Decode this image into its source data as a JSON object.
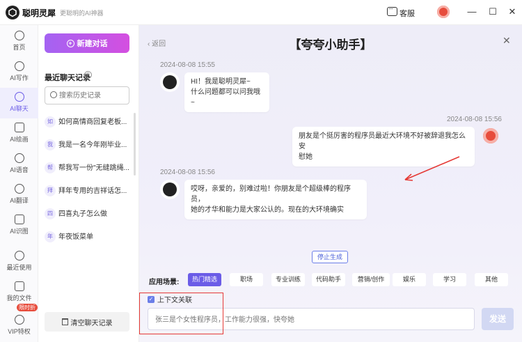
{
  "app": {
    "name": "聪明灵犀",
    "slogan": "更聪明的AI神器",
    "support_label": "客服",
    "colors": {
      "accent": "#6b5ce7",
      "new_chat_gradient": [
        "#a463f2",
        "#d44fe0"
      ],
      "highlight": "#e53935"
    }
  },
  "rail": {
    "items": [
      {
        "label": "首页",
        "icon": "hexagon-icon"
      },
      {
        "label": "AI写作",
        "icon": "pen-icon"
      },
      {
        "label": "AI聊天",
        "icon": "chat-icon",
        "active": true
      },
      {
        "label": "AI绘画",
        "icon": "brush-icon"
      },
      {
        "label": "AI语音",
        "icon": "mic-icon"
      },
      {
        "label": "AI翻译",
        "icon": "translate-icon"
      },
      {
        "label": "AI识图",
        "icon": "scan-icon"
      },
      {
        "label": "最近使用",
        "icon": "clock-icon"
      },
      {
        "label": "我的文件",
        "icon": "file-icon"
      },
      {
        "label": "VIP特权",
        "icon": "diamond-icon"
      }
    ],
    "vip_badge": "限时折"
  },
  "history": {
    "new_chat_label": "新建对话",
    "title": "最近聊天记录",
    "search_placeholder": "搜索历史记录",
    "items": [
      {
        "initial": "如",
        "text": "如何高情商回复老板..."
      },
      {
        "initial": "我",
        "text": "我是一名今年刚毕业..."
      },
      {
        "initial": "帮",
        "text": "帮我写一份\"无缝跳绳..."
      },
      {
        "initial": "拜",
        "text": "拜年专用的吉祥话怎..."
      },
      {
        "initial": "四",
        "text": "四喜丸子怎么做"
      },
      {
        "initial": "年",
        "text": "年夜饭菜单"
      }
    ],
    "clear_label": "清空聊天记录"
  },
  "chat": {
    "back_label": "返回",
    "title": "【夸夸小助手】",
    "messages": [
      {
        "role": "bot",
        "time": "2024-08-08 15:55",
        "lines": [
          "HI！我是聪明灵犀~",
          "什么问题都可以问我哦~"
        ]
      },
      {
        "role": "user",
        "time": "2024-08-08 15:56",
        "lines": [
          "朋友是个挺厉害的程序员最近大环境不好被辞退我怎么安",
          "慰她"
        ]
      },
      {
        "role": "bot",
        "time": "2024-08-08 15:56",
        "lines": [
          "哎呀，亲爱的，别难过啦！你朋友是个超级棒的程序员，",
          "她的才华和能力是大家公认的。现在的大环境确实"
        ]
      }
    ],
    "stop_label": "停止生成",
    "scene_label": "应用场景:",
    "scene_tabs": [
      "热门精选",
      "职场",
      "专业训练",
      "代码助手",
      "营销/创作",
      "娱乐",
      "学习",
      "其他"
    ],
    "context_label": "上下文关联",
    "input_placeholder": "张三是个女性程序员，工作能力很强，快夸她",
    "send_label": "发送"
  }
}
